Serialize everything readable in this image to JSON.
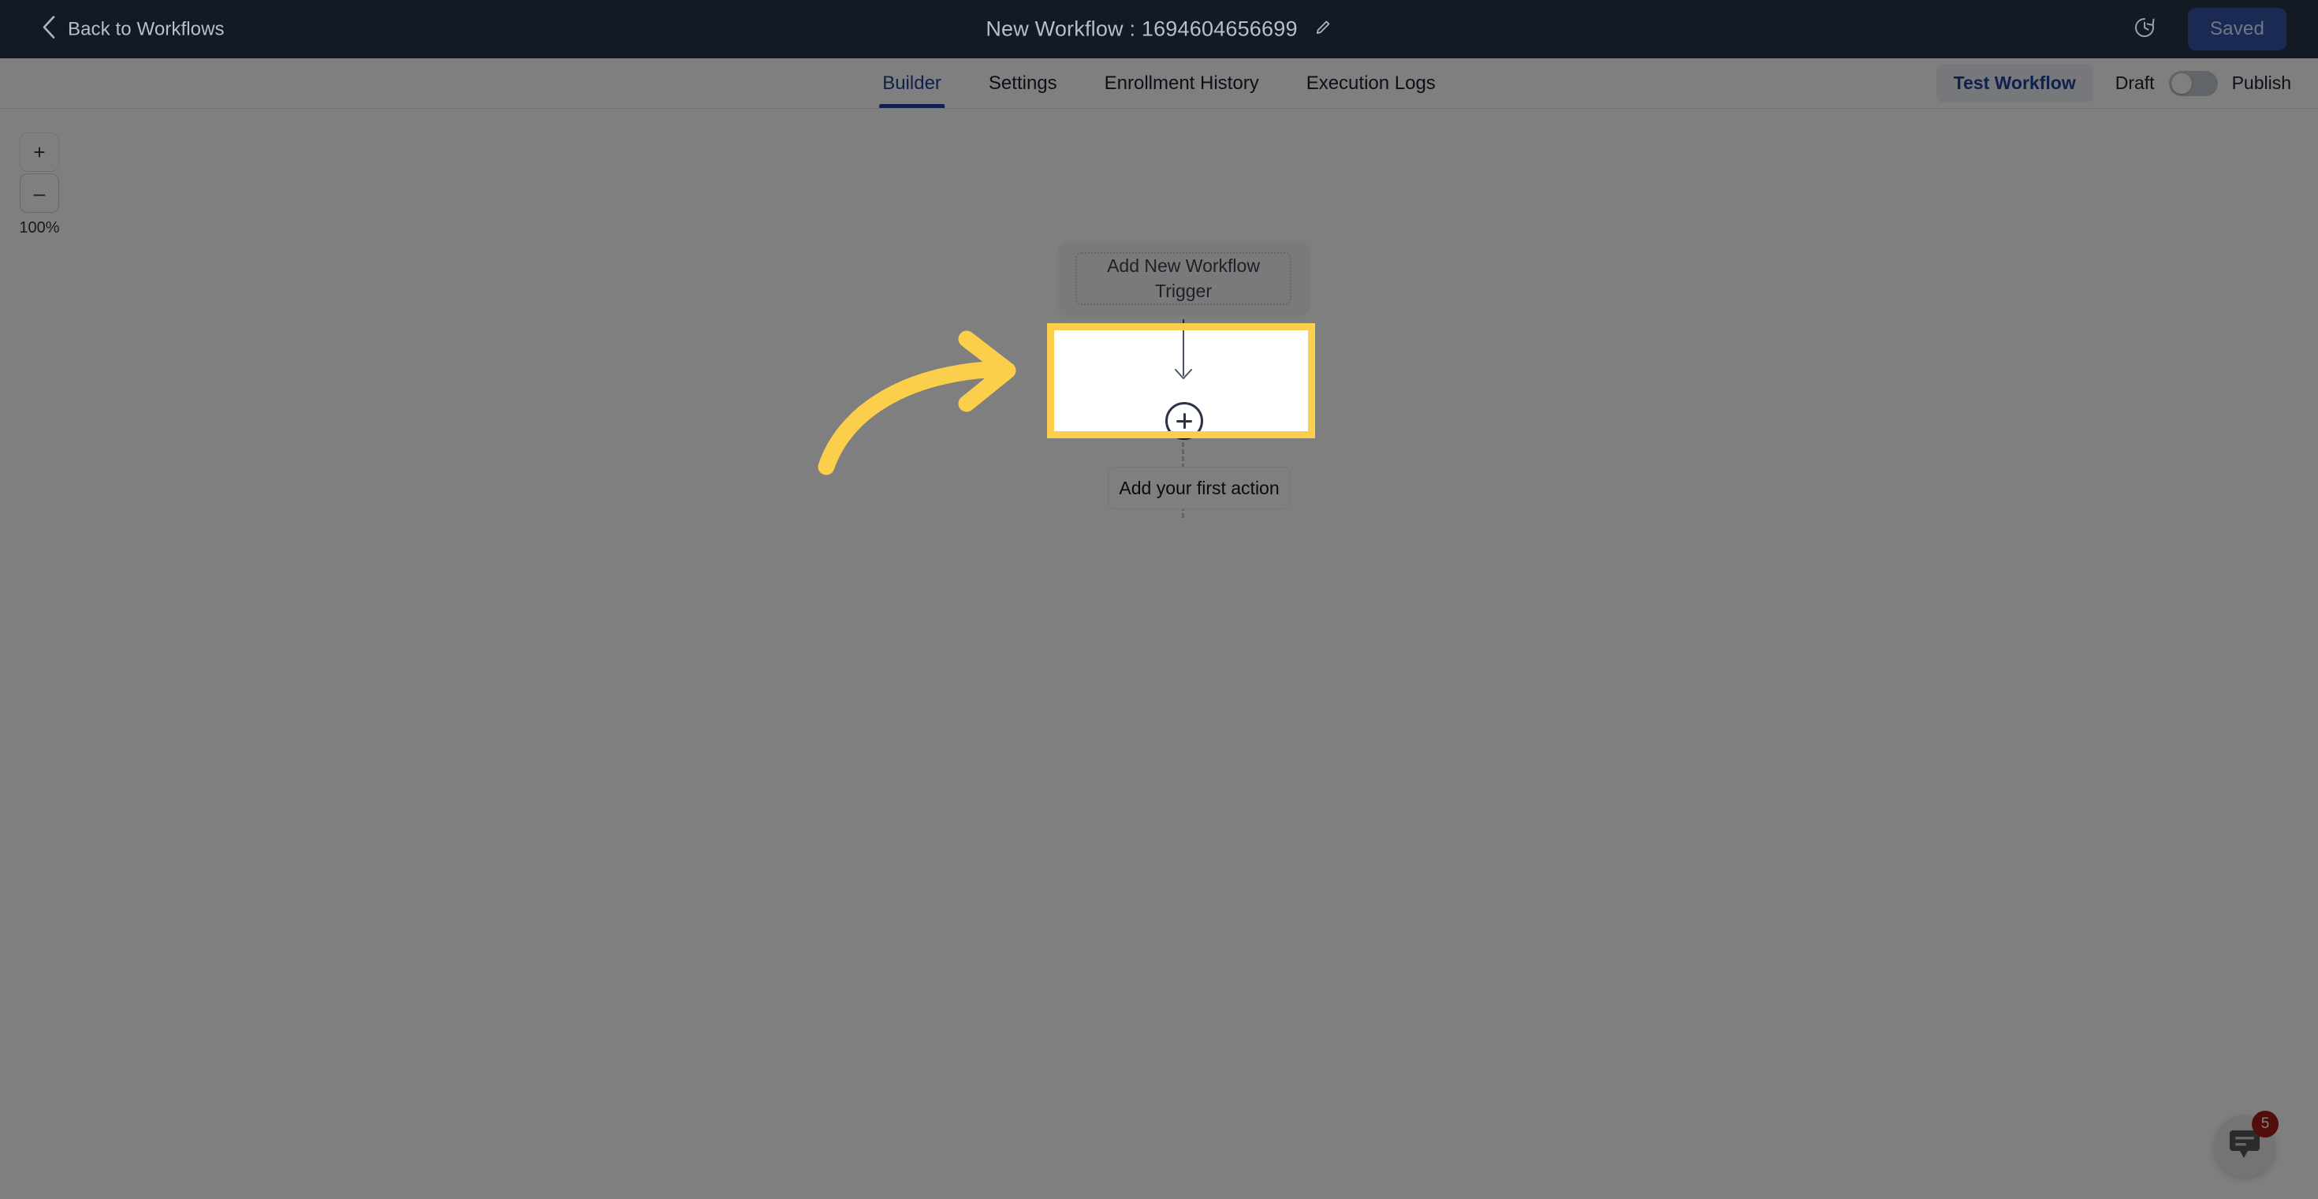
{
  "topbar": {
    "back_label": "Back to Workflows",
    "back_icon": "chevron-left-icon",
    "workflow_title": "New Workflow : 1694604656699",
    "edit_icon": "pencil-icon",
    "history_icon": "history-clock-icon",
    "save_status_label": "Saved"
  },
  "tabbar": {
    "tabs": [
      {
        "label": "Builder",
        "active": true
      },
      {
        "label": "Settings",
        "active": false
      },
      {
        "label": "Enrollment History",
        "active": false
      },
      {
        "label": "Execution Logs",
        "active": false
      }
    ],
    "test_workflow_label": "Test Workflow",
    "draft_label": "Draft",
    "publish_label": "Publish",
    "toggle_state": "off"
  },
  "canvas": {
    "zoom": {
      "zoom_in_label": "+",
      "zoom_out_label": "–",
      "zoom_level": "100%"
    },
    "trigger_node": {
      "label": "Add New Workflow Trigger"
    },
    "add_step_icon": "plus-circle-icon",
    "action_node": {
      "label": "Add your first action"
    }
  },
  "chat_widget": {
    "icon": "chat-bubble-icon",
    "unread_count": "5"
  },
  "colors": {
    "topbar_bg": "#141a24",
    "accent_blue": "#21409a",
    "highlight_yellow": "#fbce4c",
    "scrim": "rgba(0,0,0,0.5)",
    "badge_red": "#a61b1b",
    "saved_btn_bg": "#1b2a53"
  }
}
